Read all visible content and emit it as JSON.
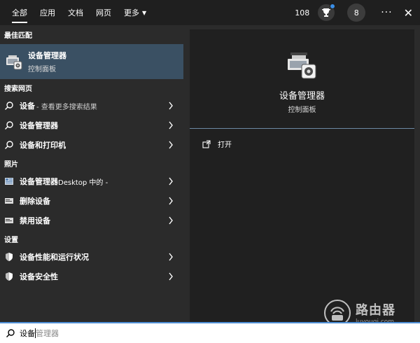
{
  "topbar": {
    "tabs": [
      {
        "label": "全部",
        "active": true
      },
      {
        "label": "应用"
      },
      {
        "label": "文档"
      },
      {
        "label": "网页"
      },
      {
        "label": "更多"
      }
    ],
    "points": "108",
    "avatar_initial": "8",
    "more_icon": "more-icon",
    "close_icon": "close-icon"
  },
  "sections": {
    "best_match": "最佳匹配",
    "web": "搜索网页",
    "photos": "照片",
    "settings": "设置"
  },
  "best_match": {
    "title": "设备管理器",
    "subtitle": "控制面板",
    "icon": "device-manager-icon"
  },
  "web_results": [
    {
      "label": "设备",
      "hint": " - 查看更多搜索结果"
    },
    {
      "label": "设备管理器",
      "hint": ""
    },
    {
      "label": "设备和打印机",
      "hint": ""
    }
  ],
  "photo_results": [
    {
      "label": "设备管理器",
      "hint": "Desktop 中的 -"
    },
    {
      "label": "删除设备",
      "hint": ""
    },
    {
      "label": "禁用设备",
      "hint": ""
    }
  ],
  "settings_results": [
    {
      "label": "设备性能和运行状况"
    },
    {
      "label": "设备安全性"
    }
  ],
  "detail": {
    "title": "设备管理器",
    "subtitle": "控制面板",
    "actions": [
      {
        "label": "打开",
        "icon": "open-icon"
      }
    ]
  },
  "search": {
    "typed": "设备",
    "suggestion": "管理器"
  },
  "watermark": {
    "title": "路由器",
    "url": "luyouqi.com"
  },
  "colors": {
    "accent": "#4f8fd6",
    "selected_bg": "#3a5063",
    "panel_bg": "#202020",
    "list_bg": "#2b2b2b"
  }
}
